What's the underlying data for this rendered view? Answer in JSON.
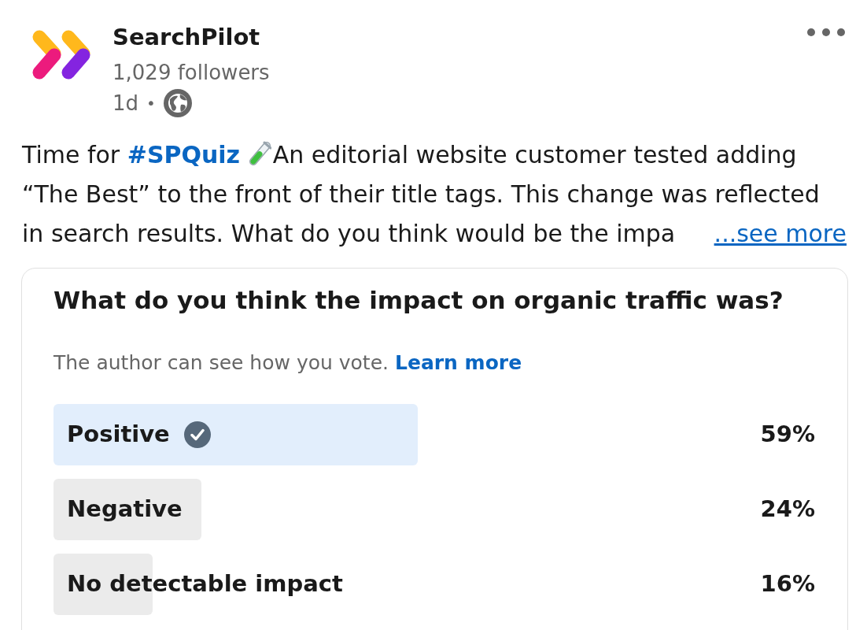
{
  "header": {
    "company": "SearchPilot",
    "followers": "1,029 followers",
    "age": "1d",
    "separator": "•"
  },
  "post": {
    "intro": "Time for ",
    "hashtag": "#SPQuiz",
    "text": "An editorial website customer tested adding “The Best” to the front of their title tags. This change was reflected in search results. What do you think would be the impa",
    "see_more": "...see more"
  },
  "poll": {
    "question": "What do you think the impact on organic traffic was?",
    "notice": "The author can see how you vote.",
    "learn_more": "Learn more",
    "options": [
      {
        "label": "Positive",
        "selected": true,
        "level": 0.59,
        "percent": "59%"
      },
      {
        "label": "Negative",
        "selected": false,
        "level": 0.24,
        "percent": "24%"
      },
      {
        "label": "No detectable impact",
        "selected": false,
        "level": 0.16,
        "percent": "16%"
      }
    ]
  }
}
